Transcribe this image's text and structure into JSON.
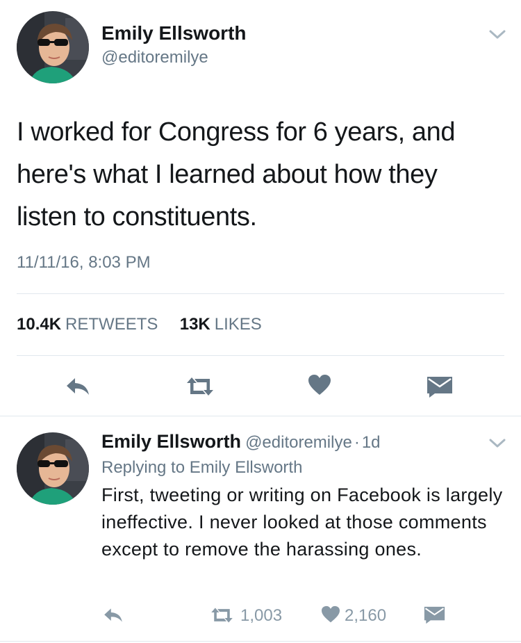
{
  "main_tweet": {
    "author_name": "Emily Ellsworth",
    "author_handle": "@editoremilye",
    "text": "I worked for Congress for 6 years, and here's what I learned about how they listen to constituents.",
    "timestamp": "11/11/16, 8:03 PM",
    "retweet_count": "10.4K",
    "retweet_label": "RETWEETS",
    "like_count": "13K",
    "like_label": "LIKES",
    "icons": {
      "reply": "reply-icon",
      "retweet": "retweet-icon",
      "like": "heart-icon",
      "dm": "envelope-icon",
      "menu": "chevron-down-icon"
    }
  },
  "reply_tweet": {
    "author_name": "Emily Ellsworth",
    "author_handle": "@editoremilye",
    "separator": "·",
    "age": "1d",
    "replying_to": "Replying to Emily Ellsworth",
    "text": "First, tweeting or writing on Facebook is largely ineffective. I never looked at those comments except to remove the harassing ones.",
    "retweet_count": "1,003",
    "like_count": "2,160"
  },
  "colors": {
    "text_primary": "#14171a",
    "text_secondary": "#657786",
    "icon_gray": "#657786",
    "icon_light": "#8899a6",
    "divider": "#e1e8ed"
  }
}
